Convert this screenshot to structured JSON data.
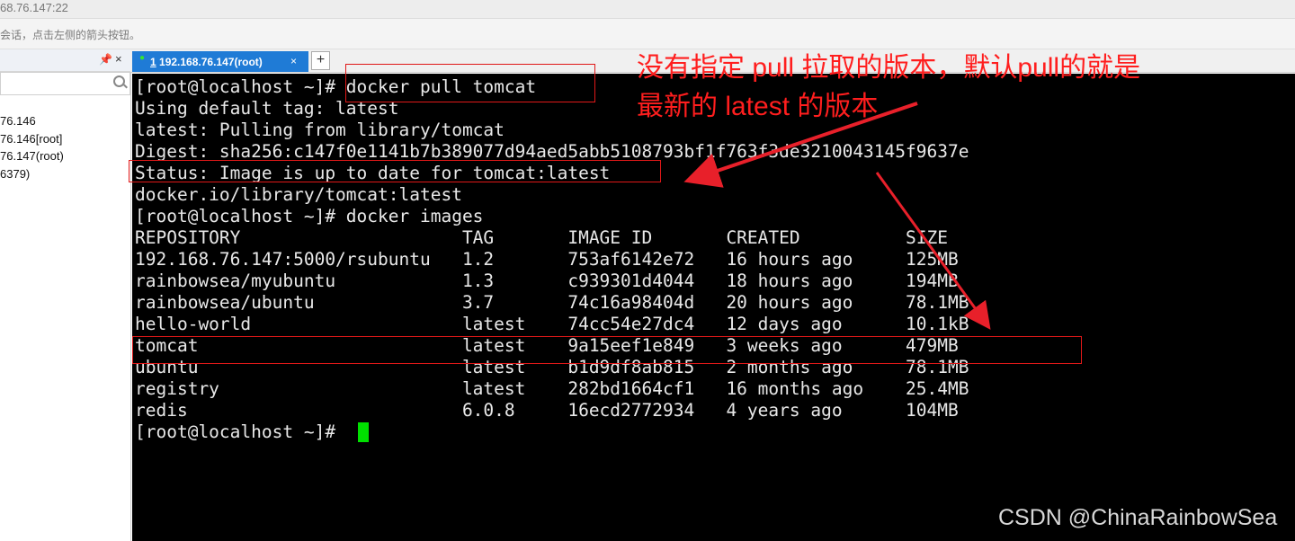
{
  "window": {
    "title_fragment": "68.76.147:22"
  },
  "hint": {
    "text": "会话，点击左侧的箭头按钮。"
  },
  "sidebar": {
    "pin_icon": "📌",
    "close_icon": "×",
    "search_placeholder": "",
    "sessions": [
      "76.146",
      "76.146[root]",
      "76.147(root)",
      "6379)"
    ]
  },
  "tabs": [
    {
      "index": "1",
      "label": "192.168.76.147(root)",
      "close": "×"
    }
  ],
  "new_tab_label": "+",
  "terminal": {
    "lines": [
      "[root@localhost ~]# docker pull tomcat",
      "Using default tag: latest",
      "latest: Pulling from library/tomcat",
      "Digest: sha256:c147f0e1141b7b389077d94aed5abb5108793bf1f763f3de3210043145f9637e",
      "Status: Image is up to date for tomcat:latest",
      "docker.io/library/tomcat:latest",
      "[root@localhost ~]# docker images",
      "REPOSITORY                     TAG       IMAGE ID       CREATED          SIZE",
      "192.168.76.147:5000/rsubuntu   1.2       753af6142e72   16 hours ago     125MB",
      "rainbowsea/myubuntu            1.3       c939301d4044   18 hours ago     194MB",
      "rainbowsea/ubuntu              3.7       74c16a98404d   20 hours ago     78.1MB",
      "hello-world                    latest    74cc54e27dc4   12 days ago      10.1kB",
      "tomcat                         latest    9a15eef1e849   3 weeks ago      479MB",
      "ubuntu                         latest    b1d9df8ab815   2 months ago     78.1MB",
      "registry                       latest    282bd1664cf1   16 months ago    25.4MB",
      "redis                          6.0.8     16ecd2772934   4 years ago      104MB",
      "[root@localhost ~]# "
    ]
  },
  "annotation": {
    "line1": "没有指定 pull 拉取的版本，默认pull的就是",
    "line2": "最新的 latest 的版本"
  },
  "watermark": "CSDN @ChinaRainbowSea",
  "colors": {
    "annotation": "#ff1e1e",
    "tab_active": "#1f7bd6",
    "cursor": "#00e000",
    "terminal_bg": "#000000"
  }
}
